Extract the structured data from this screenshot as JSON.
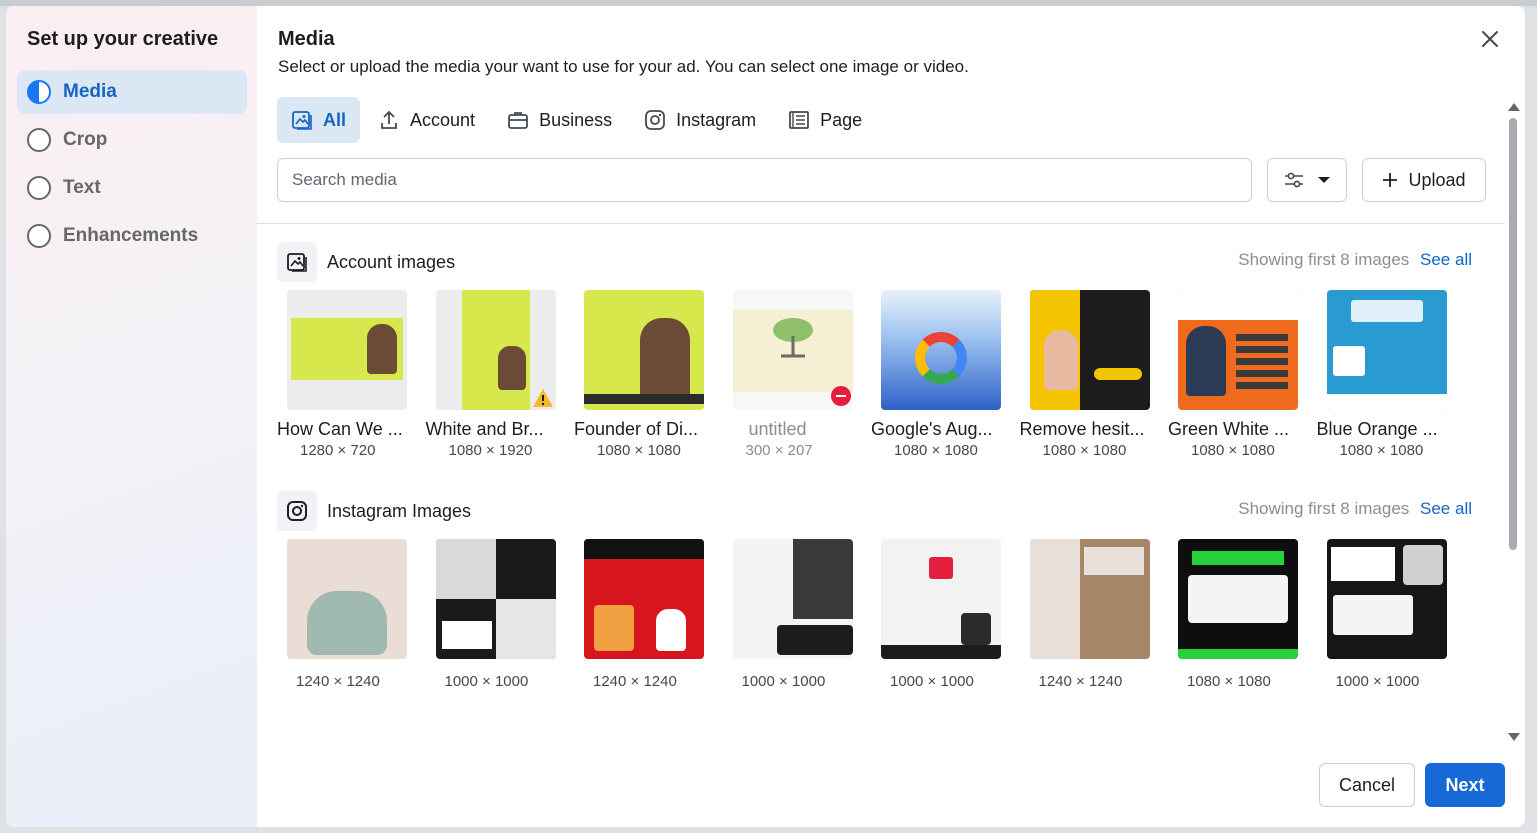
{
  "sidebar": {
    "title": "Set up your creative",
    "steps": [
      {
        "label": "Media",
        "active": true
      },
      {
        "label": "Crop",
        "active": false
      },
      {
        "label": "Text",
        "active": false
      },
      {
        "label": "Enhancements",
        "active": false
      }
    ]
  },
  "header": {
    "title": "Media",
    "subtitle": "Select or upload the media your want to use for your ad. You can select one image or video."
  },
  "tabs": [
    {
      "label": "All",
      "icon": "images-icon",
      "active": true
    },
    {
      "label": "Account",
      "icon": "upload-arrow-icon"
    },
    {
      "label": "Business",
      "icon": "briefcase-icon"
    },
    {
      "label": "Instagram",
      "icon": "instagram-icon"
    },
    {
      "label": "Page",
      "icon": "page-icon"
    }
  ],
  "search": {
    "placeholder": "Search media",
    "value": ""
  },
  "upload_label": "Upload",
  "account_images": {
    "title": "Account images",
    "showing": "Showing first 8 images",
    "see_all": "See all",
    "items": [
      {
        "name": "How Can We ...",
        "dims": "1280 × 720",
        "color": "#d7e84d"
      },
      {
        "name": "White and Br...",
        "dims": "1080 × 1920",
        "color": "#d7e84d"
      },
      {
        "name": "Founder of Di...",
        "dims": "1080 × 1080",
        "color": "#d7e84d"
      },
      {
        "name": "untitled",
        "dims": "300 × 207",
        "color": "#f5efd3"
      },
      {
        "name": "Google's Aug...",
        "dims": "1080 × 1080",
        "color": "#3b6fd8"
      },
      {
        "name": "Remove hesit...",
        "dims": "1080 × 1080",
        "color": "#1c1c1c"
      },
      {
        "name": "Green White ...",
        "dims": "1080 × 1080",
        "color": "#f06a1d"
      },
      {
        "name": "Blue Orange ...",
        "dims": "1080 × 1080",
        "color": "#2a9bd1"
      }
    ]
  },
  "instagram_images": {
    "title": "Instagram Images",
    "showing": "Showing first 8 images",
    "see_all": "See all",
    "items": [
      {
        "dims": "1240 × 1240",
        "color": "#e9ddd5"
      },
      {
        "dims": "1000 × 1000",
        "color": "#1a1a1a"
      },
      {
        "dims": "1240 × 1240",
        "color": "#d6161c"
      },
      {
        "dims": "1000 × 1000",
        "color": "#2b2b2b"
      },
      {
        "dims": "1000 × 1000",
        "color": "#f2f2f2"
      },
      {
        "dims": "1240 × 1240",
        "color": "#a68568"
      },
      {
        "dims": "1080 × 1080",
        "color": "#0e0e0e"
      },
      {
        "dims": "1000 × 1000",
        "color": "#161616"
      }
    ]
  },
  "footer": {
    "cancel": "Cancel",
    "next": "Next"
  },
  "colors": {
    "accent": "#1669d6",
    "active_bg": "#dbe7f5",
    "active_text": "#1565c0"
  }
}
